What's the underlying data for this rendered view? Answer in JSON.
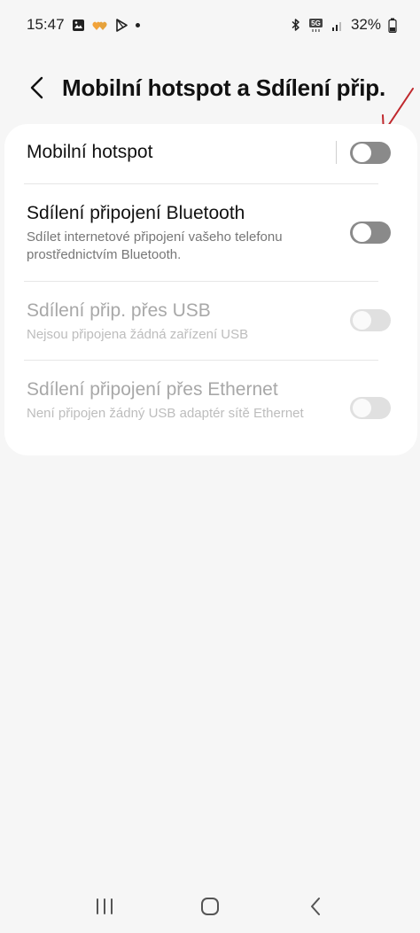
{
  "status_bar": {
    "time": "15:47",
    "battery_percent": "32%",
    "network_badge": "5G",
    "icons_left": [
      "gallery-icon",
      "hearts-icon",
      "play-store-icon",
      "notification-dot-icon"
    ],
    "icons_right": [
      "bluetooth-icon",
      "5g-icon",
      "signal-icon",
      "battery-icon"
    ]
  },
  "header": {
    "title": "Mobilní hotspot a Sdílení přip.",
    "back_icon": "chevron-left-icon"
  },
  "annotation": {
    "icon": "red-arrow-annotation",
    "color": "#c0282d"
  },
  "settings": {
    "hotspot": {
      "title": "Mobilní hotspot",
      "enabled": false
    },
    "bluetooth": {
      "title": "Sdílení připojení Bluetooth",
      "subtitle": "Sdílet internetové připojení vašeho telefonu prostřednictvím Bluetooth.",
      "enabled": false
    },
    "usb": {
      "title": "Sdílení přip. přes USB",
      "subtitle": "Nejsou připojena žádná zařízení USB",
      "enabled": false,
      "available": false
    },
    "ethernet": {
      "title": "Sdílení připojení přes Ethernet",
      "subtitle": "Není připojen žádný USB adaptér sítě Ethernet",
      "enabled": false,
      "available": false
    }
  },
  "nav_bar": {
    "buttons": [
      "recents-icon",
      "home-icon",
      "back-icon"
    ]
  },
  "colors": {
    "background": "#f6f6f6",
    "card": "#ffffff",
    "toggle_off": "#8a8a8a",
    "toggle_disabled": "#e0e0e0",
    "annotation_arrow": "#c0282d"
  }
}
